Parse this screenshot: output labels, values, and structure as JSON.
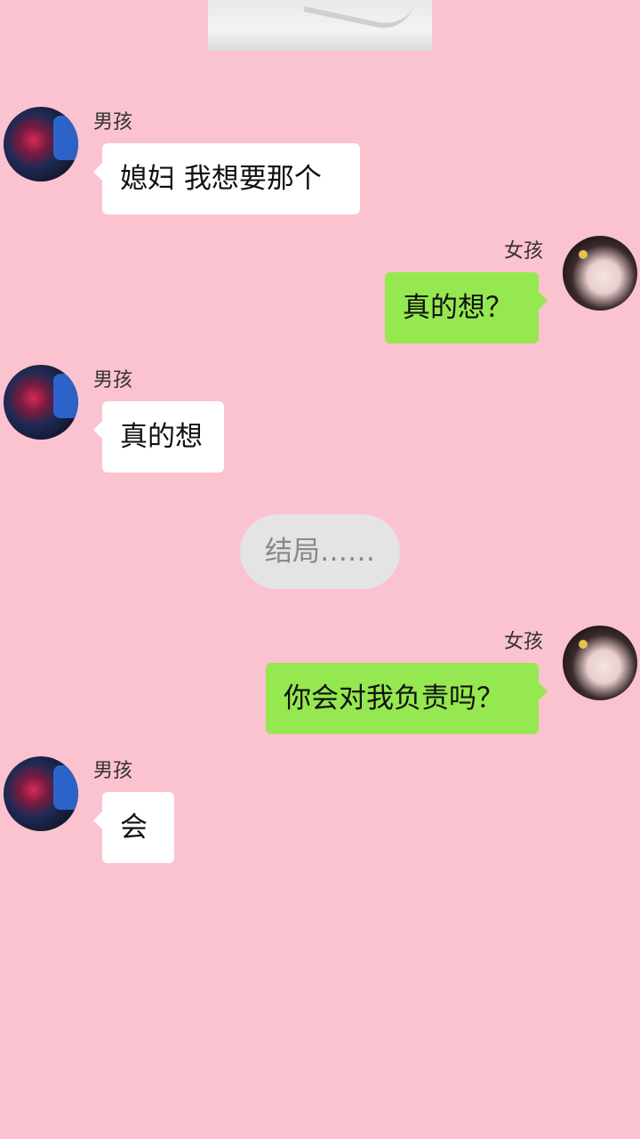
{
  "messages": [
    {
      "side": "left",
      "sender": "男孩",
      "text": "媳妇  我想要那个"
    },
    {
      "side": "right",
      "sender": "女孩",
      "text": "真的想？"
    },
    {
      "side": "left",
      "sender": "男孩",
      "text": "真的想"
    },
    {
      "side": "right",
      "sender": "女孩",
      "text": "你会对我负责吗？"
    },
    {
      "side": "left",
      "sender": "男孩",
      "text": "会"
    }
  ],
  "system_note": "结局……",
  "colors": {
    "background": "#fbc2cf",
    "incoming_bubble": "#ffffff",
    "outgoing_bubble": "#95e84f",
    "system_pill": "#e4e4e4"
  }
}
